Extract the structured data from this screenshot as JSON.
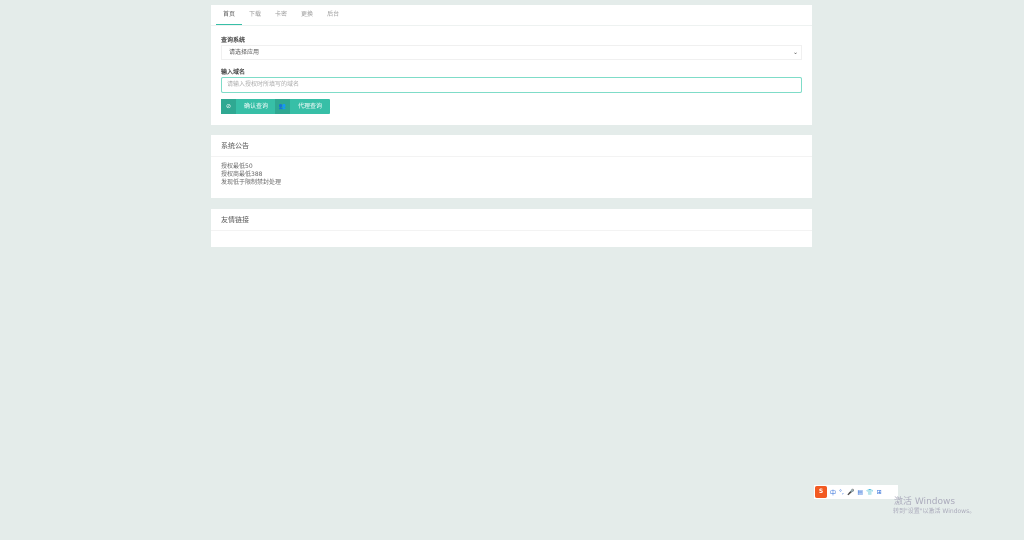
{
  "tabs": [
    "首页",
    "下载",
    "卡密",
    "更换",
    "后台"
  ],
  "query": {
    "system_label": "查询系统",
    "select_value": "请选择应用",
    "domain_label": "输入域名",
    "domain_placeholder": "请输入授权时所填写的域名",
    "confirm_button": "确认查询",
    "agent_button": "代理查询"
  },
  "notice": {
    "title": "系统公告",
    "lines": [
      "授权最低50",
      "授权商最低388",
      "发现低于限制禁封处理"
    ]
  },
  "links": {
    "title": "友情链接"
  },
  "colors": {
    "accent": "#37bfa7",
    "background": "#e4ecea"
  },
  "ime": {
    "logo": "S",
    "mode": "中"
  },
  "watermark": {
    "title": "激活 Windows",
    "subtitle": "转到\"设置\"以激活 Windows。"
  }
}
